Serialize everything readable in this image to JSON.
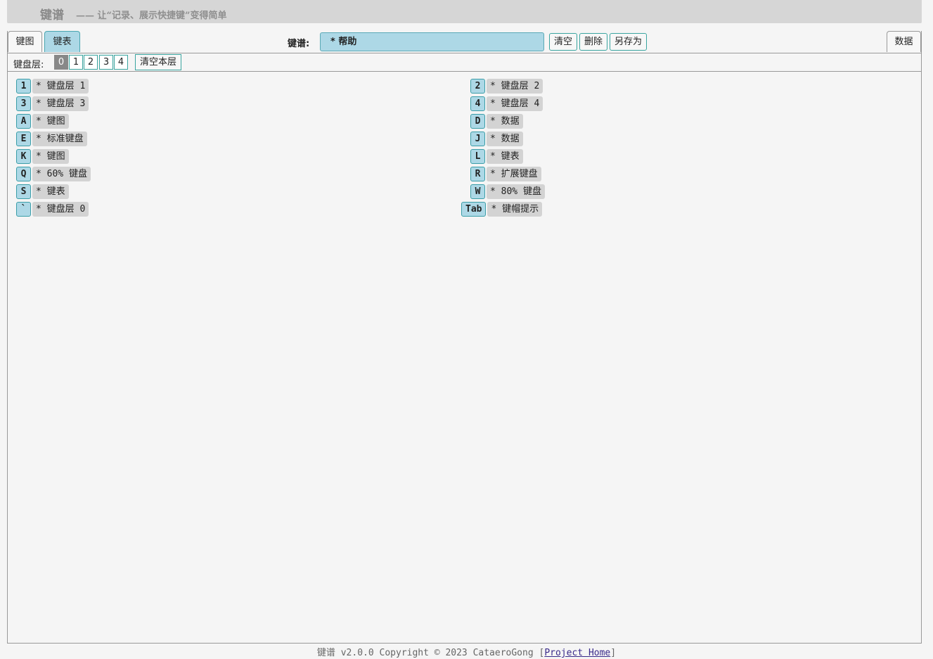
{
  "banner": {
    "app_name": "键谱",
    "slogan": "—— 让“记录、展示快捷键”变得简单"
  },
  "toolbar": {
    "tab_map": "键图",
    "tab_table": "键表",
    "active_tab": "键表",
    "keymap_label": "键谱:",
    "keymap_value": "* 帮助",
    "clear_label": "清空",
    "delete_label": "删除",
    "saveas_label": "另存为",
    "data_tab": "数据"
  },
  "layerbar": {
    "label": "键盘层:",
    "layers": [
      "0",
      "1",
      "2",
      "3",
      "4"
    ],
    "active_layer": "0",
    "clear_layer_label": "清空本层"
  },
  "keys": {
    "left": [
      {
        "key": "1",
        "desc": "* 键盘层 1"
      },
      {
        "key": "3",
        "desc": "* 键盘层 3"
      },
      {
        "key": "A",
        "desc": "* 键图"
      },
      {
        "key": "E",
        "desc": "* 标准键盘"
      },
      {
        "key": "K",
        "desc": "* 键图"
      },
      {
        "key": "Q",
        "desc": "* 60% 键盘"
      },
      {
        "key": "S",
        "desc": "* 键表"
      },
      {
        "key": "`",
        "desc": "* 键盘层 0"
      }
    ],
    "right": [
      {
        "key": "2",
        "desc": "* 键盘层 2"
      },
      {
        "key": "4",
        "desc": "* 键盘层 4"
      },
      {
        "key": "D",
        "desc": "* 数据"
      },
      {
        "key": "J",
        "desc": "* 数据"
      },
      {
        "key": "L",
        "desc": "* 键表"
      },
      {
        "key": "R",
        "desc": "* 扩展键盘"
      },
      {
        "key": "W",
        "desc": "* 80% 键盘"
      },
      {
        "key": "Tab",
        "desc": "* 键帽提示"
      }
    ]
  },
  "footer": {
    "text": "键谱 v2.0.0 Copyright © 2023 CataeroGong [",
    "link": "Project Home",
    "end": "]"
  }
}
